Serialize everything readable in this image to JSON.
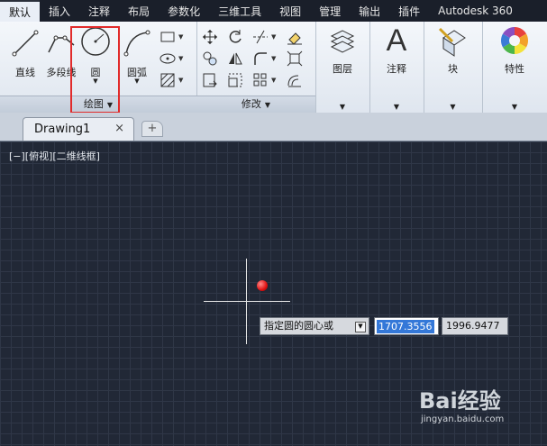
{
  "ribbon_tabs": [
    "默认",
    "插入",
    "注释",
    "布局",
    "参数化",
    "三维工具",
    "视图",
    "管理",
    "输出",
    "插件",
    "Autodesk 360"
  ],
  "draw_panel": {
    "title": "绘图",
    "tools": {
      "line": "直线",
      "polyline": "多段线",
      "circle": "圆",
      "arc": "圆弧"
    }
  },
  "modify_panel": {
    "title": "修改"
  },
  "layer_panel": {
    "label": "图层"
  },
  "annotation_panel": {
    "label": "注释"
  },
  "block_panel": {
    "label": "块"
  },
  "properties_panel": {
    "label": "特性"
  },
  "document": {
    "tab_name": "Drawing1",
    "close_glyph": "×",
    "new_tab_glyph": "+"
  },
  "viewport": {
    "label": "[−][俯视][二维线框]"
  },
  "dynamic_input": {
    "prompt": "指定圆的圆心或",
    "x_value": "1707.3556",
    "y_value": "1996.9477"
  },
  "watermark": {
    "brand": "Bai经验",
    "url": "jingyan.baidu.com"
  },
  "colors": {
    "canvas_bg": "#212836",
    "highlight_box": "#e12b2b",
    "selected_value_bg": "#3478d8"
  }
}
